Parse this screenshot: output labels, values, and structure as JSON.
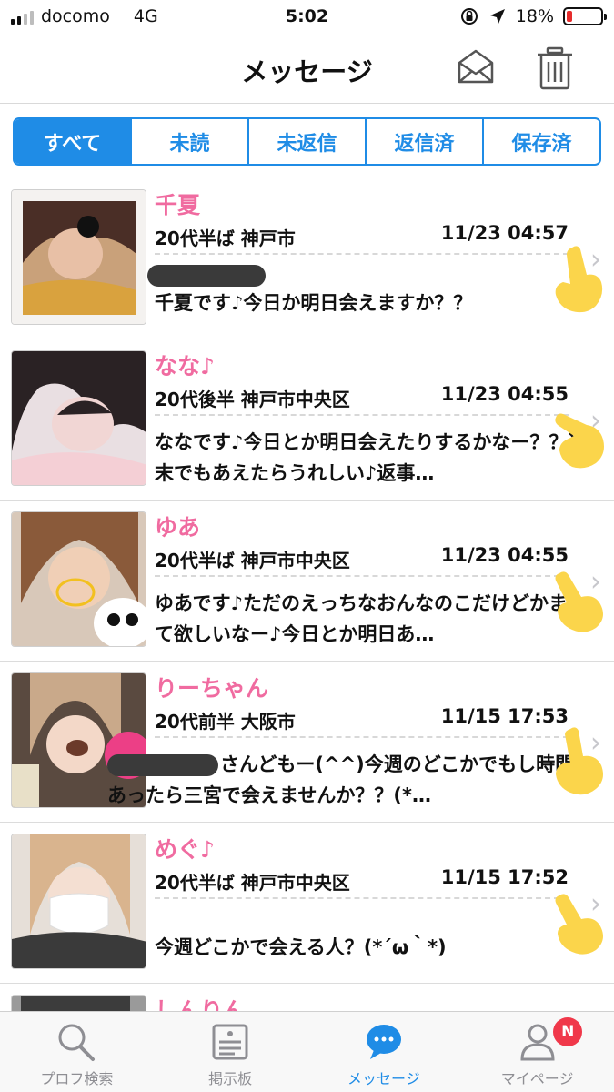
{
  "status_bar": {
    "carrier": "docomo",
    "network": "4G",
    "time": "5:02",
    "battery": "18%",
    "battery_level": 0.18
  },
  "header": {
    "title": "メッセージ",
    "icons": [
      "envelope-icon",
      "trash-icon"
    ]
  },
  "filters": {
    "selected": "すべて",
    "items": [
      "すべて",
      "未読",
      "未返信",
      "返信済",
      "保存済"
    ]
  },
  "messages": [
    {
      "name": "千夏",
      "meta": "20代半ば 神戸市",
      "datetime": "11/23 04:57",
      "preview": "千夏です♪今日か明日会えますか？？",
      "redacted": true
    },
    {
      "name": "なな♪",
      "meta": "20代後半 神戸市中央区",
      "datetime": "11/23 04:55",
      "preview": "ななです♪今日とか明日会えたりするかなー？？週末でもあえたらうれしい♪返事…"
    },
    {
      "name": "ゆあ",
      "meta": "20代半ば 神戸市中央区",
      "datetime": "11/23 04:55",
      "preview": "ゆあです♪ただのえっちなおんなのこだけどかまって欲しいなー♪今日とか明日あ…"
    },
    {
      "name": "りーちゃん",
      "meta": "20代前半 大阪市",
      "datetime": "11/15 17:53",
      "preview": "さんどもー(^^)今週のどこかでもし時間あったら三宮で会えませんか？？(*…",
      "redacted_inline": true
    },
    {
      "name": "めぐ♪",
      "meta": "20代半ば 神戸市中央区",
      "datetime": "11/15 17:52",
      "preview": "今週どこかで会える人？(*´ω｀*)"
    },
    {
      "name": "しんりん",
      "meta": "",
      "datetime": "",
      "preview": ""
    }
  ],
  "tab_bar": {
    "items": [
      {
        "label": "プロフ検索",
        "icon": "magnifier-icon"
      },
      {
        "label": "掲示板",
        "icon": "board-icon"
      },
      {
        "label": "メッセージ",
        "icon": "chat-bubble-icon",
        "active": true
      },
      {
        "label": "マイページ",
        "icon": "person-icon",
        "badge": "N"
      }
    ]
  },
  "colors": {
    "accent": "#1f8ce6",
    "name_pink": "#f06ba0",
    "badge_red": "#f0384a",
    "battery_red": "#e62c2c"
  }
}
